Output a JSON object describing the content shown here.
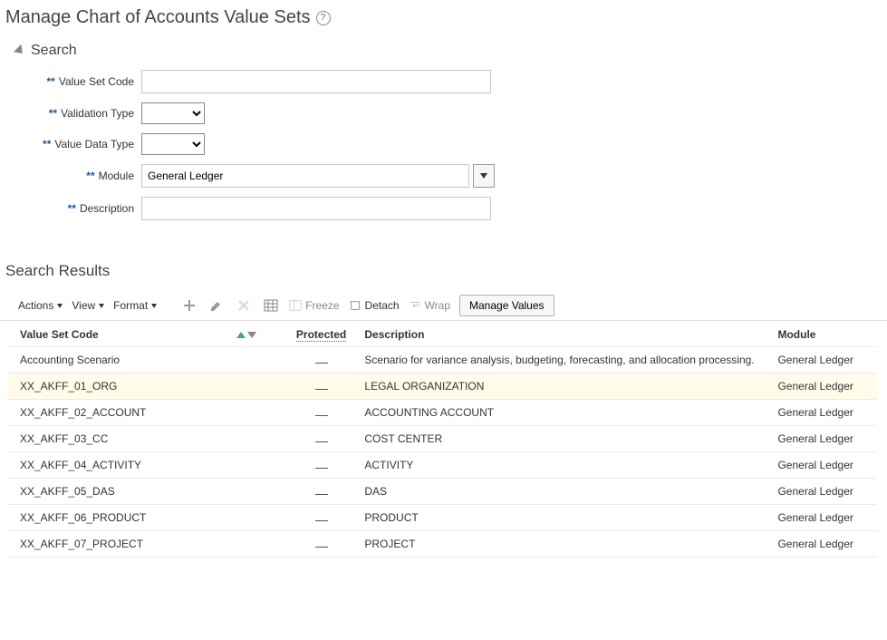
{
  "page": {
    "title": "Manage Chart of Accounts Value Sets"
  },
  "search": {
    "header": "Search",
    "fields": {
      "value_set_code": {
        "label": "Value Set Code",
        "value": ""
      },
      "validation_type": {
        "label": "Validation Type",
        "value": ""
      },
      "value_data_type": {
        "label": "Value Data Type",
        "value": ""
      },
      "module": {
        "label": "Module",
        "value": "General Ledger"
      },
      "description": {
        "label": "Description",
        "value": ""
      }
    }
  },
  "results": {
    "title": "Search Results",
    "toolbar": {
      "actions": "Actions",
      "view": "View",
      "format": "Format",
      "freeze": "Freeze",
      "detach": "Detach",
      "wrap": "Wrap",
      "manage_values": "Manage Values"
    },
    "columns": {
      "value_set_code": "Value Set Code",
      "protected": "Protected",
      "description": "Description",
      "module": "Module"
    },
    "rows": [
      {
        "code": "Accounting Scenario",
        "protected": "_",
        "description": "Scenario for variance analysis, budgeting, forecasting, and allocation processing.",
        "module": "General Ledger",
        "hl": false
      },
      {
        "code": "XX_AKFF_01_ORG",
        "protected": "_",
        "description": "LEGAL ORGANIZATION",
        "module": "General Ledger",
        "hl": true
      },
      {
        "code": "XX_AKFF_02_ACCOUNT",
        "protected": "_",
        "description": "ACCOUNTING ACCOUNT",
        "module": "General Ledger",
        "hl": false
      },
      {
        "code": "XX_AKFF_03_CC",
        "protected": "_",
        "description": "COST CENTER",
        "module": "General Ledger",
        "hl": false
      },
      {
        "code": "XX_AKFF_04_ACTIVITY",
        "protected": "_",
        "description": "ACTIVITY",
        "module": "General Ledger",
        "hl": false
      },
      {
        "code": "XX_AKFF_05_DAS",
        "protected": "_",
        "description": "DAS",
        "module": "General Ledger",
        "hl": false
      },
      {
        "code": "XX_AKFF_06_PRODUCT",
        "protected": "_",
        "description": "PRODUCT",
        "module": "General Ledger",
        "hl": false
      },
      {
        "code": "XX_AKFF_07_PROJECT",
        "protected": "_",
        "description": "PROJECT",
        "module": "General Ledger",
        "hl": false
      }
    ]
  }
}
